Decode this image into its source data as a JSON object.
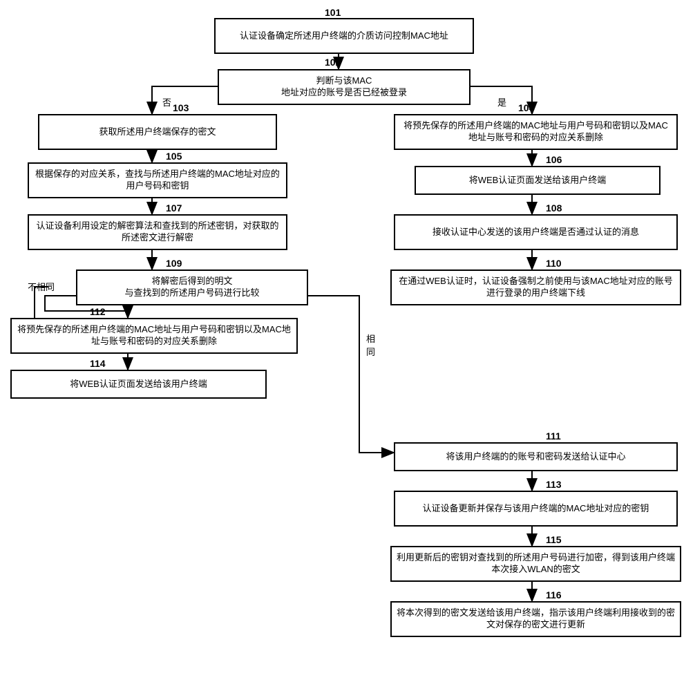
{
  "nodes": {
    "n101": {
      "num": "101",
      "text": "认证设备确定所述用户终端的介质访问控制MAC地址"
    },
    "n102": {
      "num": "102",
      "text": "判断与该MAC\n地址对应的账号是否已经被登录"
    },
    "n103": {
      "num": "103",
      "text": "获取所述用户终端保存的密文"
    },
    "n104": {
      "num": "104",
      "text": "将预先保存的所述用户终端的MAC地址与用户号码和密钥以及MAC地址与账号和密码的对应关系删除"
    },
    "n105": {
      "num": "105",
      "text": "根据保存的对应关系，查找与所述用户终端的MAC地址对应的用户号码和密钥"
    },
    "n106": {
      "num": "106",
      "text": "将WEB认证页面发送给该用户终端"
    },
    "n107": {
      "num": "107",
      "text": "认证设备利用设定的解密算法和查找到的所述密钥，对获取的所述密文进行解密"
    },
    "n108": {
      "num": "108",
      "text": "接收认证中心发送的该用户终端是否通过认证的消息"
    },
    "n109": {
      "num": "109",
      "text": "将解密后得到的明文\n与查找到的所述用户号码进行比较"
    },
    "n110": {
      "num": "110",
      "text": "在通过WEB认证时，认证设备强制之前使用与该MAC地址对应的账号进行登录的用户终端下线"
    },
    "n111": {
      "num": "111",
      "text": "将该用户终端的的账号和密码发送给认证中心"
    },
    "n112": {
      "num": "112",
      "text": "将预先保存的所述用户终端的MAC地址与用户号码和密钥以及MAC地址与账号和密码的对应关系删除"
    },
    "n113": {
      "num": "113",
      "text": "认证设备更新并保存与该用户终端的MAC地址对应的密钥"
    },
    "n114": {
      "num": "114",
      "text": "将WEB认证页面发送给该用户终端"
    },
    "n115": {
      "num": "115",
      "text": "利用更新后的密钥对查找到的所述用户号码进行加密，得到该用户终端本次接入WLAN的密文"
    },
    "n116": {
      "num": "116",
      "text": "将本次得到的密文发送给该用户终端，指示该用户终端利用接收到的密文对保存的密文进行更新"
    }
  },
  "edges": {
    "no": "否",
    "yes": "是",
    "diff": "不相同",
    "same": "相\n同"
  }
}
